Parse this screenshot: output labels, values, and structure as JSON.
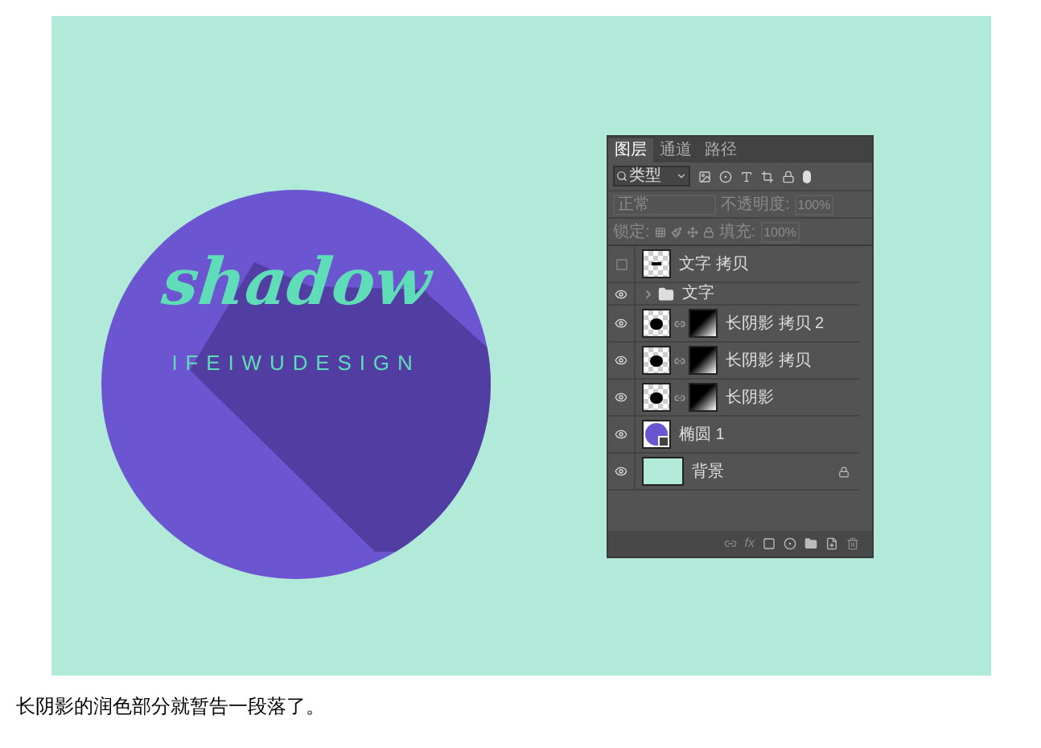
{
  "artwork": {
    "title": "shadow",
    "subtitle": "IFEIWUDESIGN"
  },
  "layers_panel": {
    "tabs": [
      {
        "label": "图层",
        "selected": true
      },
      {
        "label": "通道",
        "selected": false
      },
      {
        "label": "路径",
        "selected": false
      }
    ],
    "filter": {
      "value": "类型"
    },
    "blend_mode": {
      "value": "正常",
      "disabled": true
    },
    "opacity": {
      "label": "不透明度:",
      "value": "100%",
      "disabled": true
    },
    "lock": {
      "label": "锁定:",
      "disabled": true
    },
    "fill": {
      "label": "填充:",
      "value": "100%",
      "disabled": true
    },
    "layers": [
      {
        "name": "文字 拷贝",
        "kind": "text",
        "visible": false,
        "locked": false
      },
      {
        "name": "文字",
        "kind": "group",
        "visible": true,
        "locked": false,
        "expanded": false
      },
      {
        "name": "长阴影 拷贝 2",
        "kind": "masked",
        "visible": true,
        "locked": false
      },
      {
        "name": "长阴影 拷贝",
        "kind": "masked",
        "visible": true,
        "locked": false
      },
      {
        "name": "长阴影",
        "kind": "masked",
        "visible": true,
        "locked": false
      },
      {
        "name": "椭圆 1",
        "kind": "shape",
        "visible": true,
        "locked": false
      },
      {
        "name": "背景",
        "kind": "fill",
        "visible": true,
        "locked": true
      }
    ],
    "fx": "fx"
  },
  "caption": "长阴影的润色部分就暂告一段落了。"
}
